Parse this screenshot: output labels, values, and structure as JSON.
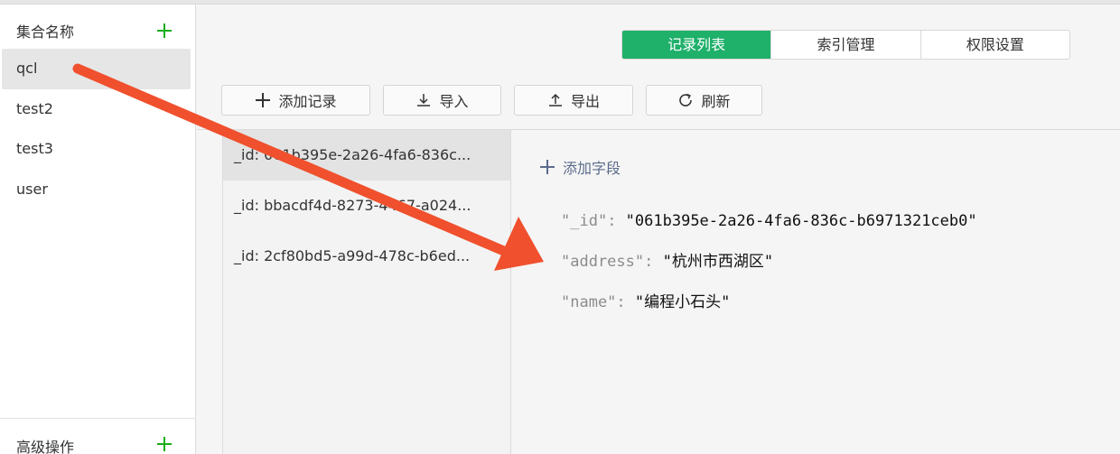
{
  "sidebar": {
    "title": "集合名称",
    "collections": [
      "qcl",
      "test2",
      "test3",
      "user"
    ],
    "footer_label": "高级操作"
  },
  "tabs": [
    {
      "label": "记录列表",
      "active": true
    },
    {
      "label": "索引管理",
      "active": false
    },
    {
      "label": "权限设置",
      "active": false
    }
  ],
  "toolbar": {
    "add_record": "添加记录",
    "import": "导入",
    "export": "导出",
    "refresh": "刷新"
  },
  "records": [
    "_id: 061b395e-2a26-4fa6-836c...",
    "_id: bbacdf4d-8273-4467-a024...",
    "_id: 2cf80bd5-a99d-478c-b6ed..."
  ],
  "detail": {
    "add_field": "添加字段",
    "fields": [
      {
        "key": "\"_id\"",
        "sep": ": ",
        "value": "\"061b395e-2a26-4fa6-836c-b6971321ceb0\""
      },
      {
        "key": "\"address\"",
        "sep": ": ",
        "value": "\"杭州市西湖区\""
      },
      {
        "key": "\"name\"",
        "sep": ": ",
        "value": "\"编程小石头\""
      }
    ]
  },
  "colors": {
    "accent": "#1fb06a",
    "arrow": "#f0502d"
  },
  "icons": [
    "plus-icon",
    "download-icon",
    "upload-icon",
    "refresh-icon"
  ]
}
